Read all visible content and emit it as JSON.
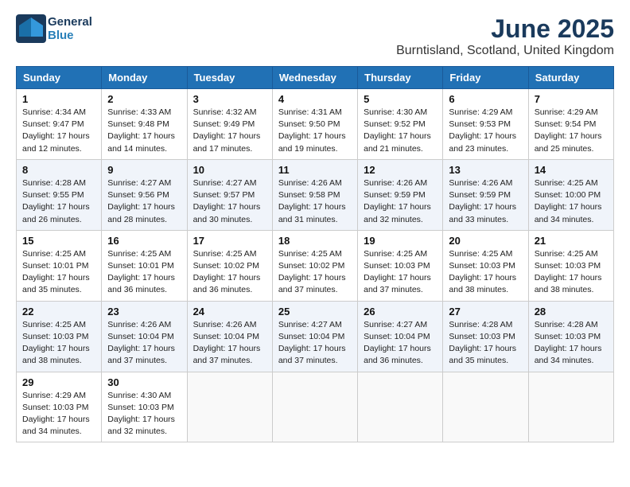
{
  "header": {
    "logo_line1": "General",
    "logo_line2": "Blue",
    "month": "June 2025",
    "location": "Burntisland, Scotland, United Kingdom"
  },
  "days_of_week": [
    "Sunday",
    "Monday",
    "Tuesday",
    "Wednesday",
    "Thursday",
    "Friday",
    "Saturday"
  ],
  "weeks": [
    [
      {
        "day": "1",
        "detail": "Sunrise: 4:34 AM\nSunset: 9:47 PM\nDaylight: 17 hours\nand 12 minutes."
      },
      {
        "day": "2",
        "detail": "Sunrise: 4:33 AM\nSunset: 9:48 PM\nDaylight: 17 hours\nand 14 minutes."
      },
      {
        "day": "3",
        "detail": "Sunrise: 4:32 AM\nSunset: 9:49 PM\nDaylight: 17 hours\nand 17 minutes."
      },
      {
        "day": "4",
        "detail": "Sunrise: 4:31 AM\nSunset: 9:50 PM\nDaylight: 17 hours\nand 19 minutes."
      },
      {
        "day": "5",
        "detail": "Sunrise: 4:30 AM\nSunset: 9:52 PM\nDaylight: 17 hours\nand 21 minutes."
      },
      {
        "day": "6",
        "detail": "Sunrise: 4:29 AM\nSunset: 9:53 PM\nDaylight: 17 hours\nand 23 minutes."
      },
      {
        "day": "7",
        "detail": "Sunrise: 4:29 AM\nSunset: 9:54 PM\nDaylight: 17 hours\nand 25 minutes."
      }
    ],
    [
      {
        "day": "8",
        "detail": "Sunrise: 4:28 AM\nSunset: 9:55 PM\nDaylight: 17 hours\nand 26 minutes."
      },
      {
        "day": "9",
        "detail": "Sunrise: 4:27 AM\nSunset: 9:56 PM\nDaylight: 17 hours\nand 28 minutes."
      },
      {
        "day": "10",
        "detail": "Sunrise: 4:27 AM\nSunset: 9:57 PM\nDaylight: 17 hours\nand 30 minutes."
      },
      {
        "day": "11",
        "detail": "Sunrise: 4:26 AM\nSunset: 9:58 PM\nDaylight: 17 hours\nand 31 minutes."
      },
      {
        "day": "12",
        "detail": "Sunrise: 4:26 AM\nSunset: 9:59 PM\nDaylight: 17 hours\nand 32 minutes."
      },
      {
        "day": "13",
        "detail": "Sunrise: 4:26 AM\nSunset: 9:59 PM\nDaylight: 17 hours\nand 33 minutes."
      },
      {
        "day": "14",
        "detail": "Sunrise: 4:25 AM\nSunset: 10:00 PM\nDaylight: 17 hours\nand 34 minutes."
      }
    ],
    [
      {
        "day": "15",
        "detail": "Sunrise: 4:25 AM\nSunset: 10:01 PM\nDaylight: 17 hours\nand 35 minutes."
      },
      {
        "day": "16",
        "detail": "Sunrise: 4:25 AM\nSunset: 10:01 PM\nDaylight: 17 hours\nand 36 minutes."
      },
      {
        "day": "17",
        "detail": "Sunrise: 4:25 AM\nSunset: 10:02 PM\nDaylight: 17 hours\nand 36 minutes."
      },
      {
        "day": "18",
        "detail": "Sunrise: 4:25 AM\nSunset: 10:02 PM\nDaylight: 17 hours\nand 37 minutes."
      },
      {
        "day": "19",
        "detail": "Sunrise: 4:25 AM\nSunset: 10:03 PM\nDaylight: 17 hours\nand 37 minutes."
      },
      {
        "day": "20",
        "detail": "Sunrise: 4:25 AM\nSunset: 10:03 PM\nDaylight: 17 hours\nand 38 minutes."
      },
      {
        "day": "21",
        "detail": "Sunrise: 4:25 AM\nSunset: 10:03 PM\nDaylight: 17 hours\nand 38 minutes."
      }
    ],
    [
      {
        "day": "22",
        "detail": "Sunrise: 4:25 AM\nSunset: 10:03 PM\nDaylight: 17 hours\nand 38 minutes."
      },
      {
        "day": "23",
        "detail": "Sunrise: 4:26 AM\nSunset: 10:04 PM\nDaylight: 17 hours\nand 37 minutes."
      },
      {
        "day": "24",
        "detail": "Sunrise: 4:26 AM\nSunset: 10:04 PM\nDaylight: 17 hours\nand 37 minutes."
      },
      {
        "day": "25",
        "detail": "Sunrise: 4:27 AM\nSunset: 10:04 PM\nDaylight: 17 hours\nand 37 minutes."
      },
      {
        "day": "26",
        "detail": "Sunrise: 4:27 AM\nSunset: 10:04 PM\nDaylight: 17 hours\nand 36 minutes."
      },
      {
        "day": "27",
        "detail": "Sunrise: 4:28 AM\nSunset: 10:03 PM\nDaylight: 17 hours\nand 35 minutes."
      },
      {
        "day": "28",
        "detail": "Sunrise: 4:28 AM\nSunset: 10:03 PM\nDaylight: 17 hours\nand 34 minutes."
      }
    ],
    [
      {
        "day": "29",
        "detail": "Sunrise: 4:29 AM\nSunset: 10:03 PM\nDaylight: 17 hours\nand 34 minutes."
      },
      {
        "day": "30",
        "detail": "Sunrise: 4:30 AM\nSunset: 10:03 PM\nDaylight: 17 hours\nand 32 minutes."
      },
      {
        "day": "",
        "detail": ""
      },
      {
        "day": "",
        "detail": ""
      },
      {
        "day": "",
        "detail": ""
      },
      {
        "day": "",
        "detail": ""
      },
      {
        "day": "",
        "detail": ""
      }
    ]
  ]
}
